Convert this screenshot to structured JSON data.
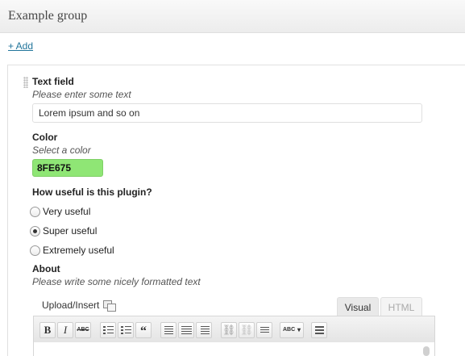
{
  "header": {
    "title": "Example group"
  },
  "add_link": "+ Add",
  "text_field": {
    "label": "Text field",
    "hint": "Please enter some text",
    "value": "Lorem ipsum and so on"
  },
  "color_field": {
    "label": "Color",
    "hint": "Select a color",
    "value": "8FE675",
    "swatch": "#8FE675"
  },
  "radio_group": {
    "label": "How useful is this plugin?",
    "options": [
      {
        "label": "Very useful",
        "checked": false
      },
      {
        "label": "Super useful",
        "checked": true
      },
      {
        "label": "Extremely useful",
        "checked": false
      }
    ]
  },
  "about_field": {
    "label": "About",
    "hint": "Please write some nicely formatted text",
    "upload_label": "Upload/Insert",
    "tabs": [
      "Visual",
      "HTML"
    ],
    "active_tab": "Visual",
    "toolbar": {
      "bold": "B",
      "italic": "I",
      "strikethrough": "ABC",
      "blockquote": "“",
      "spellcheck": "ABC"
    }
  },
  "colors": {
    "link": "#21759b",
    "color_swatch": "#8FE675"
  }
}
